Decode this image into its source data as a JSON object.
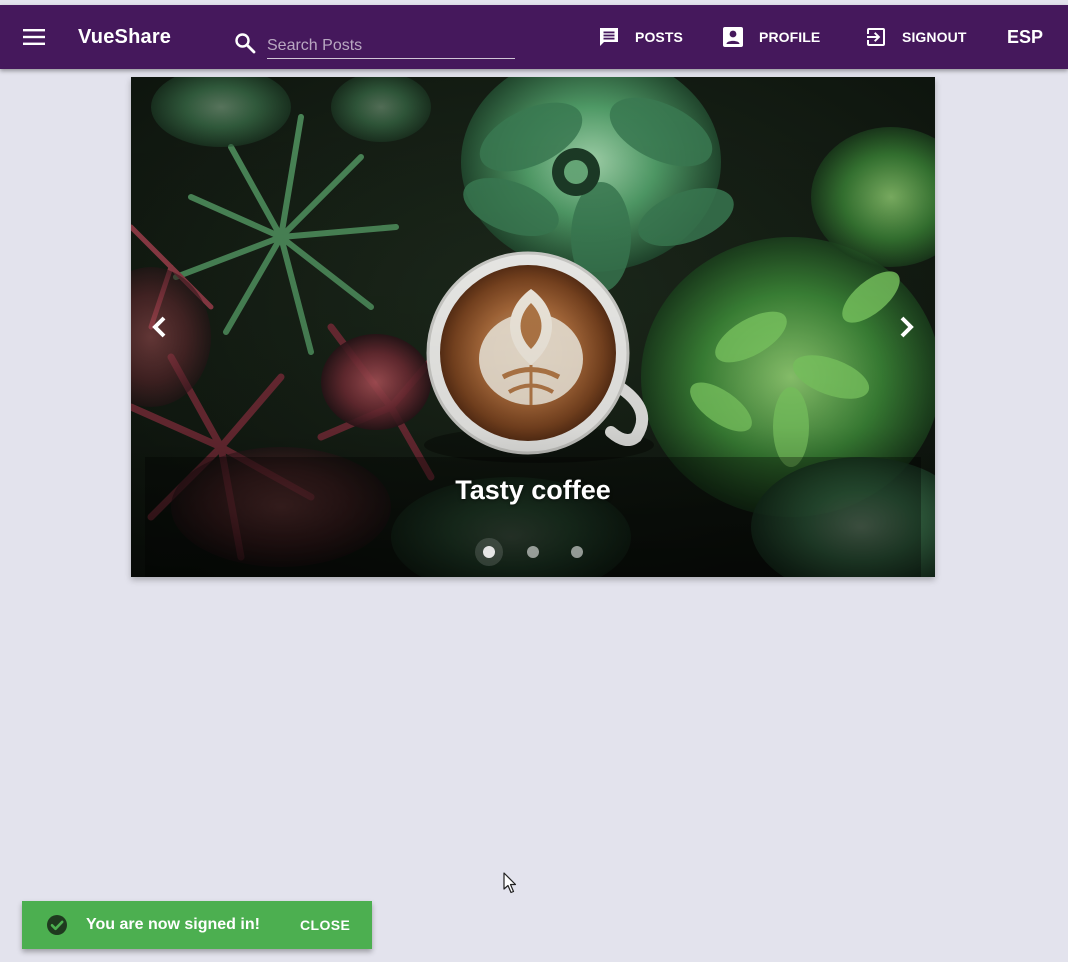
{
  "toolbar": {
    "app_title": "VueShare",
    "menu_icon": "menu-icon",
    "search": {
      "placeholder": "Search Posts",
      "value": "",
      "icon": "search-icon"
    },
    "nav": [
      {
        "label": "POSTS",
        "icon": "chat-icon"
      },
      {
        "label": "PROFILE",
        "icon": "account-box-icon"
      },
      {
        "label": "SIGNOUT",
        "icon": "exit-to-app-icon"
      }
    ],
    "language": "ESP"
  },
  "carousel": {
    "caption": "Tasty coffee",
    "prev_icon": "chevron-left-icon",
    "next_icon": "chevron-right-icon",
    "slide_count": 3,
    "active_index": 0
  },
  "snackbar": {
    "message": "You are now signed in!",
    "action": "CLOSE",
    "icon": "check-circle-icon"
  },
  "colors": {
    "toolbar": "#45185c",
    "background": "#e3e3ed",
    "snackbar": "#4caf50"
  }
}
